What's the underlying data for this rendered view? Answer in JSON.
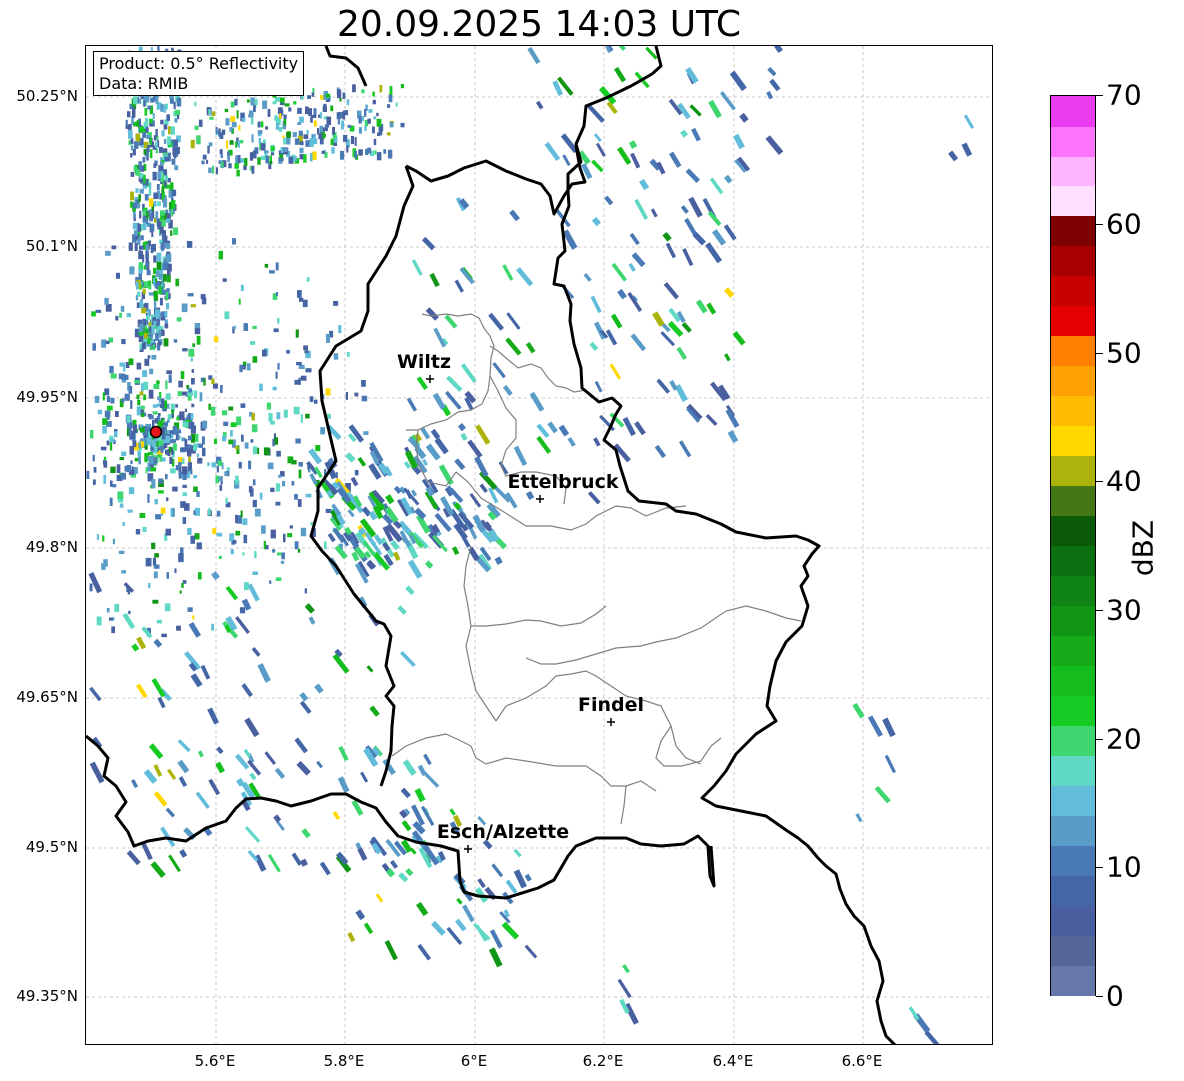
{
  "title": "20.09.2025 14:03 UTC",
  "info_box": {
    "product": "Product: 0.5° Reflectivity",
    "data": "Data: RMIB"
  },
  "lat_labels": [
    "50.25°N",
    "50.1°N",
    "49.95°N",
    "49.8°N",
    "49.65°N",
    "49.5°N",
    "49.35°N"
  ],
  "lon_labels": [
    "5.6°E",
    "5.8°E",
    "6°E",
    "6.2°E",
    "6.4°E",
    "6.6°E"
  ],
  "cities": [
    {
      "name": "Wiltz"
    },
    {
      "name": "Ettelbruck"
    },
    {
      "name": "Findel"
    },
    {
      "name": "Esch/Alzette"
    }
  ],
  "radar_site": {
    "marker_color": "#e8141c"
  },
  "colorbar": {
    "unit": "dBZ",
    "min": 0,
    "max": 70,
    "tick_labels": [
      "0",
      "10",
      "20",
      "30",
      "40",
      "50",
      "60",
      "70"
    ],
    "colors": [
      "#6677aa",
      "#556699",
      "#4a5f9f",
      "#4566a6",
      "#4a7ab6",
      "#5a9cc8",
      "#62bddb",
      "#5fd8c4",
      "#3ed66e",
      "#16cc24",
      "#14bc1c",
      "#14aa18",
      "#109614",
      "#0f8414",
      "#0d7010",
      "#0a5a0a",
      "#437814",
      "#acb40c",
      "#ffd800",
      "#ffbc00",
      "#ff9f00",
      "#ff7f00",
      "#e40000",
      "#c80000",
      "#a80000",
      "#7c0000",
      "#ffe0ff",
      "#ffb4ff",
      "#ff74ff",
      "#ea3cf0"
    ]
  },
  "colors": {
    "border": "#000000",
    "canton_border": "#808080",
    "grid": "#bbbbbb"
  }
}
